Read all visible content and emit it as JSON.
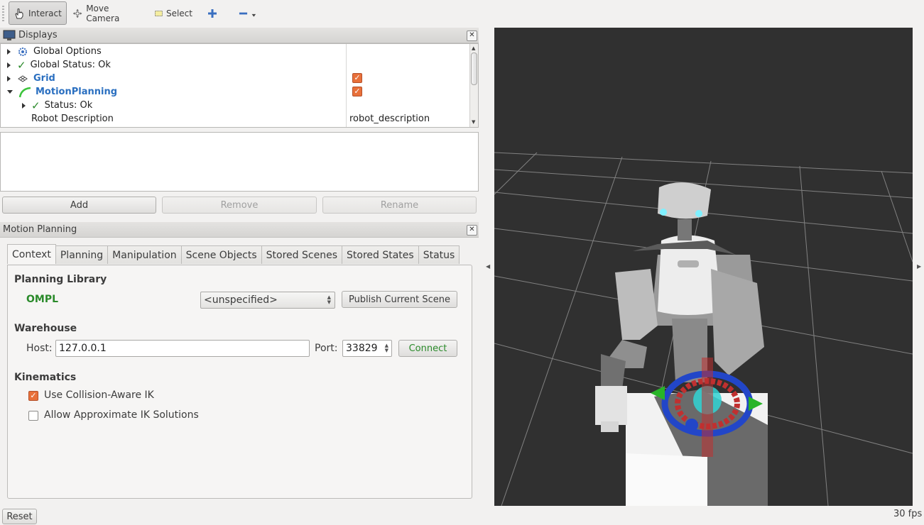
{
  "toolbar": {
    "interact": "Interact",
    "move_camera": "Move Camera",
    "select": "Select"
  },
  "displays": {
    "title": "Displays",
    "items": [
      {
        "label": "Global Options",
        "value": ""
      },
      {
        "label": "Global Status: Ok",
        "value": ""
      },
      {
        "label": "Grid",
        "value": "",
        "checked": true
      },
      {
        "label": "MotionPlanning",
        "value": "",
        "checked": true
      },
      {
        "label": "Status: Ok",
        "value": ""
      },
      {
        "label": "Robot Description",
        "value": "robot_description"
      }
    ],
    "buttons": {
      "add": "Add",
      "remove": "Remove",
      "rename": "Rename"
    }
  },
  "motion_planning": {
    "title": "Motion Planning",
    "tabs": [
      "Context",
      "Planning",
      "Manipulation",
      "Scene Objects",
      "Stored Scenes",
      "Stored States",
      "Status"
    ],
    "active_tab": "Context",
    "planning_library": {
      "heading": "Planning Library",
      "library": "OMPL",
      "planner_selected": "<unspecified>",
      "publish_button": "Publish Current Scene"
    },
    "warehouse": {
      "heading": "Warehouse",
      "host_label": "Host:",
      "host_value": "127.0.0.1",
      "port_label": "Port:",
      "port_value": "33829",
      "connect_button": "Connect"
    },
    "kinematics": {
      "heading": "Kinematics",
      "collision_aware_label": "Use Collision-Aware IK",
      "collision_aware_checked": true,
      "approx_label": "Allow Approximate IK Solutions",
      "approx_checked": false
    }
  },
  "statusbar": {
    "reset": "Reset",
    "fps": "30 fps"
  },
  "colors": {
    "accent_blue": "#2a6fc0",
    "ok_green": "#2a8a2a",
    "checkbox_orange": "#e8703a",
    "viewport_bg": "#303030"
  }
}
